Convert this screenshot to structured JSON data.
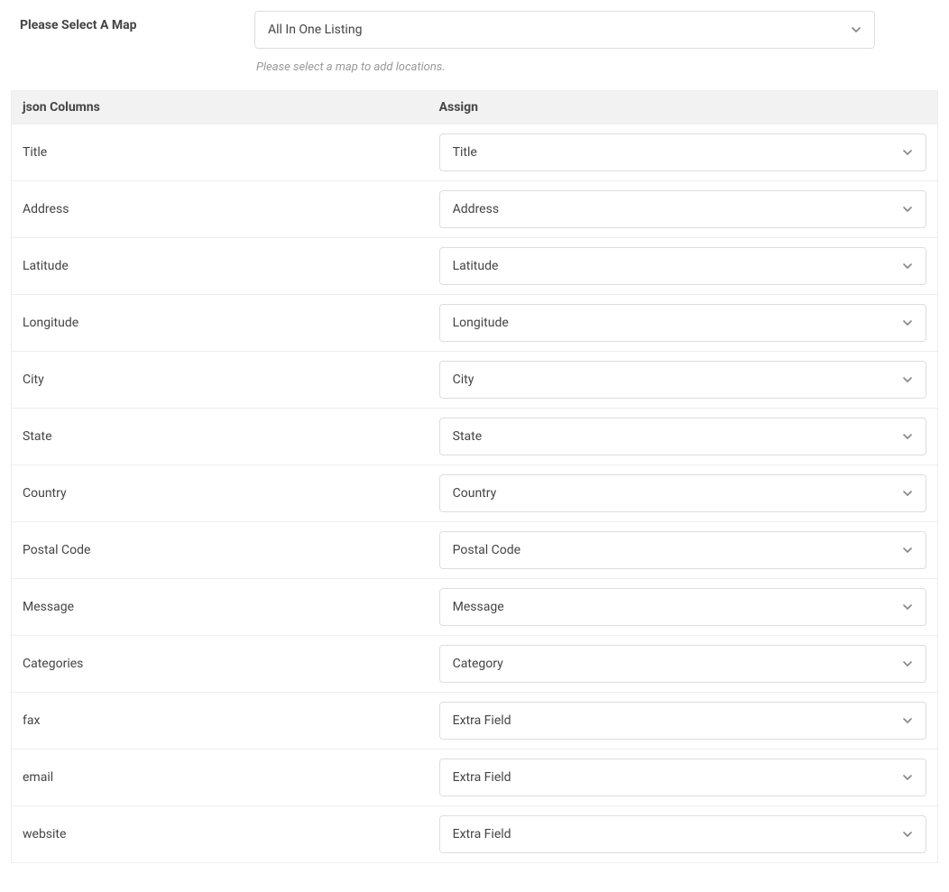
{
  "header": {
    "label": "Please Select A Map",
    "select_value": "All In One Listing",
    "helper": "Please select a map to add locations."
  },
  "table": {
    "col1": "json Columns",
    "col2": "Assign",
    "rows": [
      {
        "name": "Title",
        "value": "Title"
      },
      {
        "name": "Address",
        "value": "Address"
      },
      {
        "name": "Latitude",
        "value": "Latitude"
      },
      {
        "name": "Longitude",
        "value": "Longitude"
      },
      {
        "name": "City",
        "value": "City"
      },
      {
        "name": "State",
        "value": "State"
      },
      {
        "name": "Country",
        "value": "Country"
      },
      {
        "name": "Postal Code",
        "value": "Postal Code"
      },
      {
        "name": "Message",
        "value": "Message"
      },
      {
        "name": "Categories",
        "value": "Category"
      },
      {
        "name": "fax",
        "value": "Extra Field"
      },
      {
        "name": "email",
        "value": "Extra Field"
      },
      {
        "name": "website",
        "value": "Extra Field"
      }
    ]
  }
}
